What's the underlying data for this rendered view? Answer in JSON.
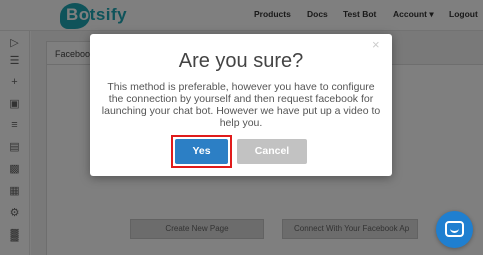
{
  "app": {
    "logo_text_first": "Bo",
    "logo_text_rest": "tsify"
  },
  "nav": {
    "products": "Products",
    "docs": "Docs",
    "test_bot": "Test Bot",
    "account": "Account ▾",
    "logout": "Logout"
  },
  "sidebar": {
    "icons": [
      "play-icon",
      "menu-icon",
      "plus-icon",
      "document-icon",
      "list-icon",
      "chat-icon",
      "car-icon",
      "image-icon",
      "gear-icon",
      "chart-icon"
    ]
  },
  "main": {
    "tab_label": "Faceboo",
    "status_items": [
      "cted",
      "nect",
      "nect"
    ],
    "create_page_button": "Create New Page",
    "connect_button": "Connect With Your Facebook Ap"
  },
  "modal": {
    "close_glyph": "×",
    "title": "Are you sure?",
    "body": "This method is preferable, however you have to configure the connection by yourself and then request facebook for launching your chat bot. However we have put up a video to help you.",
    "yes_label": "Yes",
    "cancel_label": "Cancel"
  },
  "colors": {
    "brand": "#1fa7b5",
    "primary_button": "#2c7fc5",
    "highlight_outline": "#e01b1b",
    "chat_widget": "#1f7fd0"
  }
}
